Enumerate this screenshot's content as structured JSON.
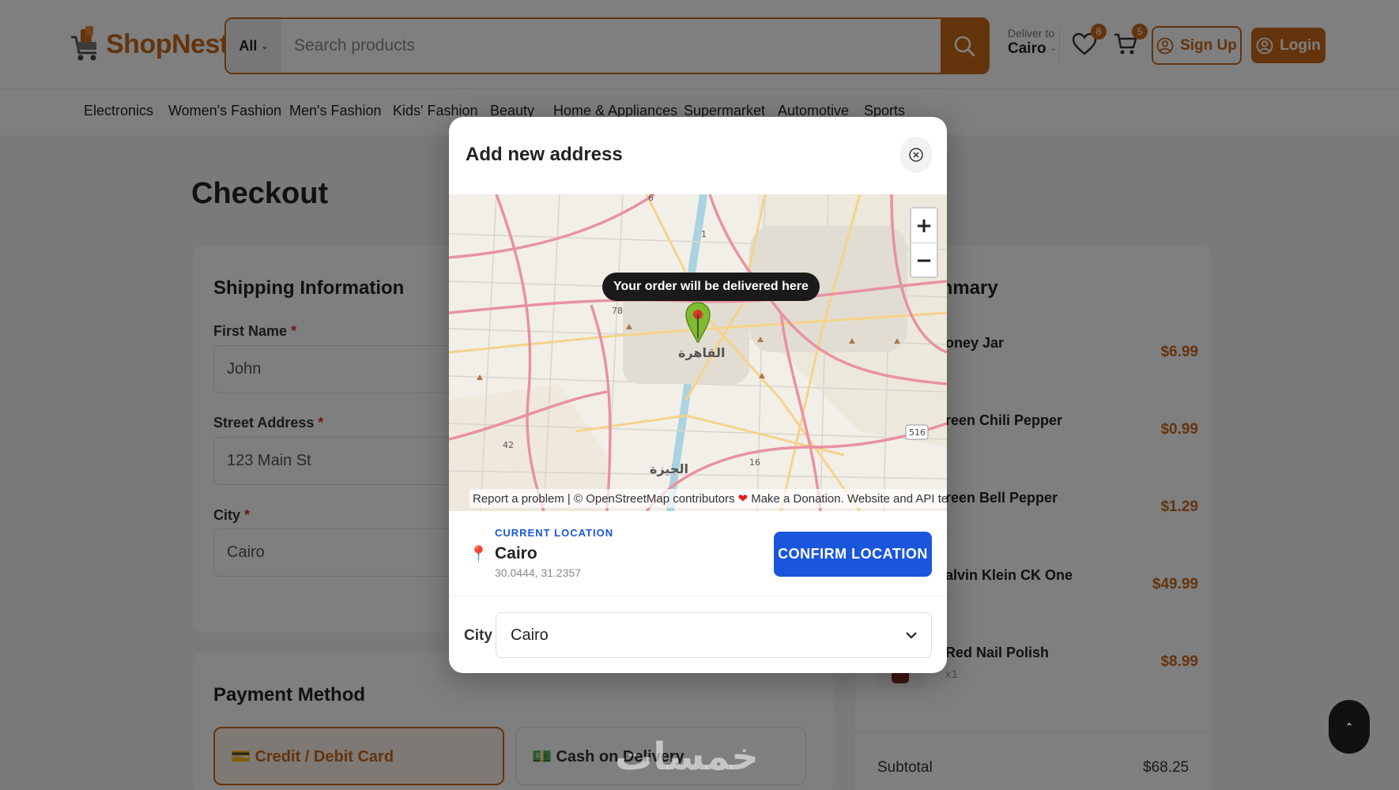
{
  "header": {
    "logo_text": "ShopNest",
    "search": {
      "category": "All",
      "placeholder": "Search products"
    },
    "deliver": {
      "label": "Deliver to",
      "city": "Cairo"
    },
    "wishlist_count": "8",
    "cart_count": "5",
    "signup_label": "Sign Up",
    "login_label": "Login"
  },
  "categories": [
    "Electronics",
    "Women's Fashion",
    "Men's Fashion",
    "Kids' Fashion",
    "Beauty",
    "Home & Appliances",
    "Supermarket",
    "Automotive",
    "Sports"
  ],
  "checkout": {
    "title": "Checkout",
    "shipping": {
      "title": "Shipping Information",
      "first_name_label": "First Name",
      "first_name_value": "John",
      "street_label": "Street Address",
      "street_value": "123 Main St",
      "city_label": "City",
      "city_value": "Cairo",
      "required_mark": "*"
    },
    "payment": {
      "title": "Payment Method",
      "option_card": "💳 Credit / Debit Card",
      "option_cash": "💵 Cash on Delivery"
    },
    "summary": {
      "title_fragment": "mmary",
      "items": [
        {
          "name": "oney Jar",
          "price": "$6.99"
        },
        {
          "name": "reen Chili Pepper",
          "price": "$0.99"
        },
        {
          "name": "reen Bell Pepper",
          "price": "$1.29"
        },
        {
          "name": "alvin Klein CK One",
          "price": "$49.99"
        },
        {
          "name": "Red Nail Polish",
          "qty": "x1",
          "price": "$8.99"
        }
      ],
      "subtotal_label": "Subtotal",
      "subtotal_value": "$68.25"
    }
  },
  "modal": {
    "title": "Add new address",
    "map": {
      "tooltip": "Your order will be delivered here",
      "place_cairo": "القاهرة",
      "place_giza": "الجيزة",
      "road_labels": [
        "6",
        "1",
        "78",
        "42",
        "516",
        "16"
      ],
      "attribution": {
        "report": "Report a problem",
        "osm": "| © OpenStreetMap contributors",
        "donate": "Make a Donation. Website and API terms"
      }
    },
    "location": {
      "label": "CURRENT LOCATION",
      "city": "Cairo",
      "coords": "30.0444, 31.2357",
      "confirm_label": "CONFIRM LOCATION"
    },
    "city_select": {
      "label": "City",
      "value": "Cairo"
    }
  },
  "watermark": "خمسات",
  "colors": {
    "accent": "#c8681a",
    "primary_blue": "#1a56db"
  }
}
